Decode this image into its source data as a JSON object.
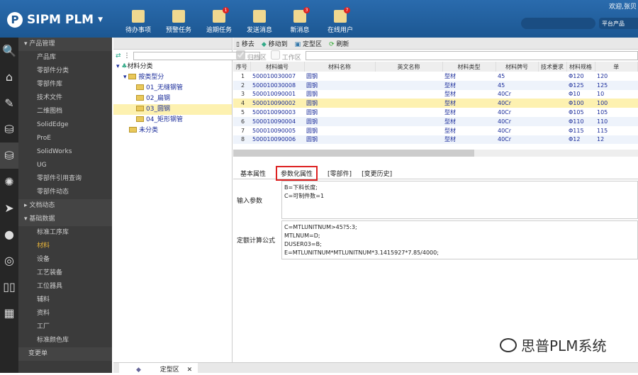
{
  "header": {
    "app_title": "SIPM PLM",
    "welcome": "欢迎,张贝",
    "platform": "平台产品",
    "toolbar": [
      {
        "label": "待办事项",
        "icon": "todo-icon",
        "badge": ""
      },
      {
        "label": "预警任务",
        "icon": "warning-task-icon",
        "badge": ""
      },
      {
        "label": "逾期任务",
        "icon": "overdue-task-icon",
        "badge": "1"
      },
      {
        "label": "发送消息",
        "icon": "send-message-icon",
        "badge": ""
      },
      {
        "label": "新消息",
        "icon": "new-message-icon",
        "badge": "3"
      },
      {
        "label": "在线用户",
        "icon": "online-users-icon",
        "badge": "7"
      }
    ]
  },
  "nav": {
    "group1": "产品管理",
    "items1": [
      "产品库",
      "零部件分类",
      "零部件库",
      "技术文件",
      "二维图档",
      "SolidEdge",
      "ProE",
      "SolidWorks",
      "UG",
      "零部件引用查询",
      "零部件动态"
    ],
    "group2": "文档动态",
    "group3": "基础数据",
    "items3": [
      "标准工序库",
      "材料",
      "设备",
      "工艺装备",
      "工位器具",
      "辅料",
      "资料",
      "工厂",
      "标准颜色库"
    ],
    "group4": "变更单"
  },
  "tree": {
    "root": "材料分类",
    "node": "按类型分",
    "children": [
      "01_无缝钢管",
      "02_扁钢",
      "03_圆钢",
      "04_矩形钢管"
    ],
    "unclassified": "未分类"
  },
  "toolbar": {
    "remove": "移去",
    "move_to": "移动到",
    "finalized": "定型区",
    "refresh": "刷新",
    "archive": "归档区",
    "work": "工作区"
  },
  "table": {
    "columns": [
      "序号",
      "材料编号",
      "材料名称",
      "英文名称",
      "材料类型",
      "材料牌号",
      "技术要求",
      "材料规格",
      "单"
    ],
    "rows": [
      [
        "1",
        "500010030007",
        "圆钢",
        "",
        "型材",
        "45",
        "",
        "Φ120",
        "120"
      ],
      [
        "2",
        "500010030008",
        "圆钢",
        "",
        "型材",
        "45",
        "",
        "Φ125",
        "125"
      ],
      [
        "3",
        "500010090001",
        "圆钢",
        "",
        "型材",
        "40Cr",
        "",
        "Φ10",
        "10"
      ],
      [
        "4",
        "500010090002",
        "圆钢",
        "",
        "型材",
        "40Cr",
        "",
        "Φ100",
        "100"
      ],
      [
        "5",
        "500010090003",
        "圆钢",
        "",
        "型材",
        "40Cr",
        "",
        "Φ105",
        "105"
      ],
      [
        "6",
        "500010090004",
        "圆钢",
        "",
        "型材",
        "40Cr",
        "",
        "Φ110",
        "110"
      ],
      [
        "7",
        "500010090005",
        "圆钢",
        "",
        "型材",
        "40Cr",
        "",
        "Φ115",
        "115"
      ],
      [
        "8",
        "500010090006",
        "圆钢",
        "",
        "型材",
        "40Cr",
        "",
        "Φ12",
        "12"
      ]
    ]
  },
  "detail": {
    "tabs": [
      "基本属性",
      "参数化属性",
      "[零部件]",
      "[变更历史]"
    ],
    "input_label": "输入参数",
    "input_value": "B=下料长度;\nC=可制件数=1",
    "formula_label": "定额计算公式",
    "formula_value": "C=MTLUNITNUM>45?5:3;\nMTLNUM=D;\nDUSER03=B;\nE=MTLUNITNUM*MTLUNITNUM*3.1415927*7.85/4000;"
  },
  "bottom_tab": "定型区",
  "watermark": "思普PLM系统"
}
